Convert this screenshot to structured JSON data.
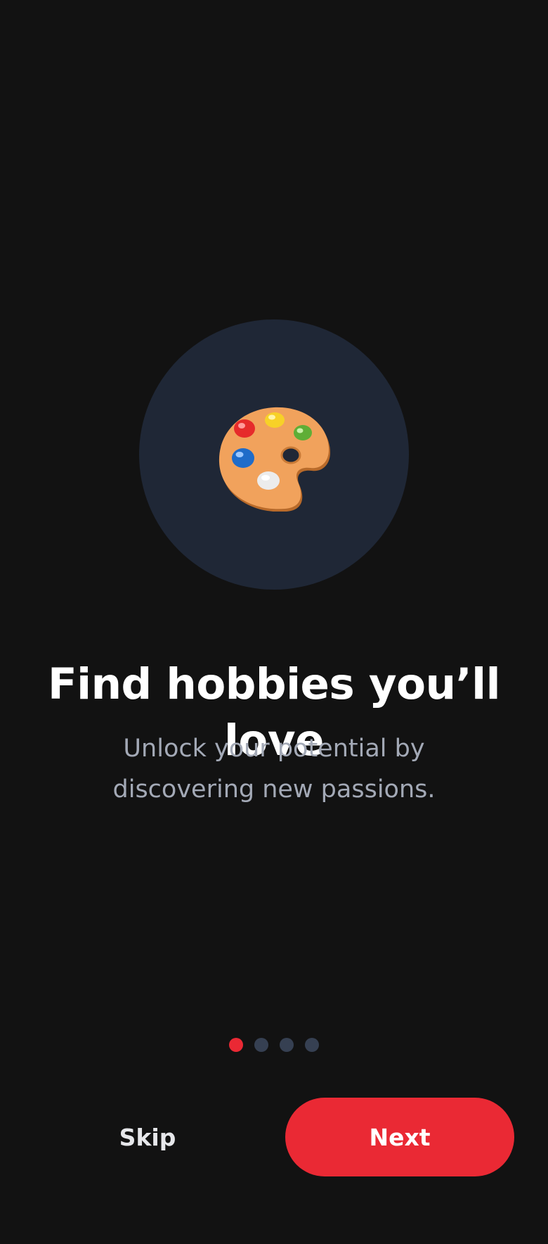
{
  "onboarding": {
    "icon": "artist-palette-icon",
    "title": "Find hobbies you’ll love",
    "subtitle": "Unlock your potential by discovering new passions.",
    "pagination": {
      "current_page": 1,
      "total_pages": 4
    },
    "skip_label": "Skip",
    "next_label": "Next"
  },
  "colors": {
    "background": "#121212",
    "circle": "#1f2736",
    "accent": "#ea2934",
    "dot_inactive": "#364052",
    "subtitle_text": "#a3a9b6"
  }
}
